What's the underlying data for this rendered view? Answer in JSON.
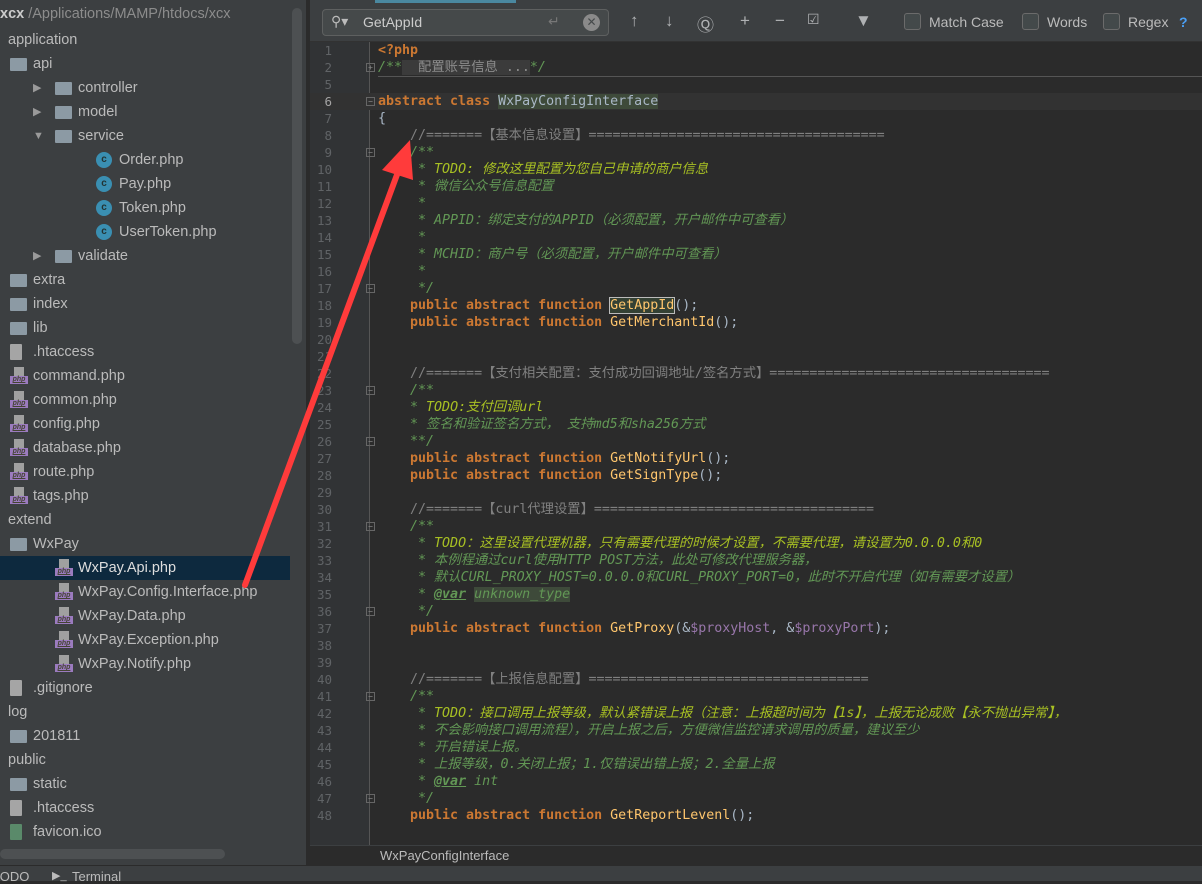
{
  "project": {
    "name": "xcx",
    "path": "/Applications/MAMP/htdocs/xcx"
  },
  "tree": [
    {
      "label": "application",
      "depth": 0,
      "icon": "module-folder"
    },
    {
      "label": "api",
      "depth": 1,
      "icon": "folder"
    },
    {
      "label": "controller",
      "depth": 2,
      "icon": "folder",
      "arrow": "collapsed"
    },
    {
      "label": "model",
      "depth": 2,
      "icon": "folder",
      "arrow": "collapsed"
    },
    {
      "label": "service",
      "depth": 2,
      "icon": "folder",
      "arrow": "expanded"
    },
    {
      "label": "Order.php",
      "depth": 3,
      "icon": "php-class"
    },
    {
      "label": "Pay.php",
      "depth": 3,
      "icon": "php-class"
    },
    {
      "label": "Token.php",
      "depth": 3,
      "icon": "php-class"
    },
    {
      "label": "UserToken.php",
      "depth": 3,
      "icon": "php-class"
    },
    {
      "label": "validate",
      "depth": 2,
      "icon": "folder",
      "arrow": "collapsed"
    },
    {
      "label": "extra",
      "depth": 1,
      "icon": "folder"
    },
    {
      "label": "index",
      "depth": 1,
      "icon": "folder"
    },
    {
      "label": "lib",
      "depth": 1,
      "icon": "folder"
    },
    {
      "label": ".htaccess",
      "depth": 1,
      "icon": "apache-file"
    },
    {
      "label": "command.php",
      "depth": 1,
      "icon": "php-file"
    },
    {
      "label": "common.php",
      "depth": 1,
      "icon": "php-file"
    },
    {
      "label": "config.php",
      "depth": 1,
      "icon": "php-file"
    },
    {
      "label": "database.php",
      "depth": 1,
      "icon": "php-file"
    },
    {
      "label": "route.php",
      "depth": 1,
      "icon": "php-file"
    },
    {
      "label": "tags.php",
      "depth": 1,
      "icon": "php-file"
    },
    {
      "label": "extend",
      "depth": 0,
      "icon": "module-folder"
    },
    {
      "label": "WxPay",
      "depth": 1,
      "icon": "folder"
    },
    {
      "label": "WxPay.Api.php",
      "depth": 2,
      "icon": "php-file",
      "selected": true
    },
    {
      "label": "WxPay.Config.Interface.php",
      "depth": 2,
      "icon": "php-file"
    },
    {
      "label": "WxPay.Data.php",
      "depth": 2,
      "icon": "php-file"
    },
    {
      "label": "WxPay.Exception.php",
      "depth": 2,
      "icon": "php-file"
    },
    {
      "label": "WxPay.Notify.php",
      "depth": 2,
      "icon": "php-file"
    },
    {
      "label": ".gitignore",
      "depth": 1,
      "icon": "text-file"
    },
    {
      "label": "log",
      "depth": 0,
      "icon": "module-folder"
    },
    {
      "label": "201811",
      "depth": 1,
      "icon": "folder"
    },
    {
      "label": "public",
      "depth": 0,
      "icon": "module-folder"
    },
    {
      "label": "static",
      "depth": 1,
      "icon": "folder"
    },
    {
      "label": ".htaccess",
      "depth": 1,
      "icon": "apache-file"
    },
    {
      "label": "favicon.ico",
      "depth": 1,
      "icon": "image-file"
    }
  ],
  "search": {
    "value": "GetAppId",
    "match_case": "Match Case",
    "words": "Words",
    "regex": "Regex",
    "help": "?"
  },
  "breadcrumb": "WxPayConfigInterface",
  "bottom_tabs": [
    "TODO",
    "Terminal"
  ],
  "colors": {
    "keyword": "#cc7832",
    "function": "#ffc66d",
    "comment": "#808080",
    "doc": "#629755",
    "todo": "#a8c023",
    "variable": "#9876aa",
    "annotation_arrow": "#ff3333"
  },
  "code": [
    {
      "n": "1",
      "t": [
        [
          "<?php",
          "kw"
        ]
      ]
    },
    {
      "n": "2",
      "t": [
        [
          "/**",
          "doc"
        ],
        [
          "  配置账号信息 ...",
          "fold"
        ],
        [
          "*/",
          "doc"
        ]
      ]
    },
    {
      "n": "5",
      "t": []
    },
    {
      "n": "6",
      "cur": true,
      "t": [
        [
          "abstract class ",
          "kw"
        ],
        [
          "WxPayConfigInterface",
          "bgv"
        ]
      ]
    },
    {
      "n": "7",
      "t": [
        [
          "{",
          ""
        ]
      ]
    },
    {
      "n": "8",
      "t": [
        [
          "    //=======【基本信息设置】=====================================",
          "cm"
        ]
      ]
    },
    {
      "n": "9",
      "t": [
        [
          "    /**",
          "doc"
        ]
      ]
    },
    {
      "n": "10",
      "t": [
        [
          "     * ",
          "doc"
        ],
        [
          "TODO: 修改这里配置为您自己申请的商户信息",
          "todo"
        ]
      ]
    },
    {
      "n": "11",
      "t": [
        [
          "     * 微信公众号信息配置",
          "doc"
        ]
      ]
    },
    {
      "n": "12",
      "t": [
        [
          "     *",
          "doc"
        ]
      ]
    },
    {
      "n": "13",
      "t": [
        [
          "     * APPID：绑定支付的APPID（必须配置，开户邮件中可查看）",
          "doc"
        ]
      ]
    },
    {
      "n": "14",
      "t": [
        [
          "     *",
          "doc"
        ]
      ]
    },
    {
      "n": "15",
      "t": [
        [
          "     * MCHID：商户号（必须配置，开户邮件中可查看）",
          "doc"
        ]
      ]
    },
    {
      "n": "16",
      "t": [
        [
          "     *",
          "doc"
        ]
      ]
    },
    {
      "n": "17",
      "t": [
        [
          "     */",
          "doc"
        ]
      ]
    },
    {
      "n": "18",
      "t": [
        [
          "    public abstract function ",
          "kw"
        ],
        [
          "GetAppId",
          "fn hl"
        ],
        [
          "();",
          ""
        ]
      ]
    },
    {
      "n": "19",
      "t": [
        [
          "    public abstract function ",
          "kw"
        ],
        [
          "GetMerchantId",
          "fn"
        ],
        [
          "();",
          ""
        ]
      ]
    },
    {
      "n": "20",
      "t": []
    },
    {
      "n": "21",
      "t": []
    },
    {
      "n": "22",
      "t": [
        [
          "    //=======【支付相关配置：支付成功回调地址/签名方式】===================================",
          "cm"
        ]
      ]
    },
    {
      "n": "23",
      "t": [
        [
          "    /**",
          "doc"
        ]
      ]
    },
    {
      "n": "24",
      "t": [
        [
          "    * ",
          "doc"
        ],
        [
          "TODO:支付回调url",
          "todo"
        ]
      ]
    },
    {
      "n": "25",
      "t": [
        [
          "    * 签名和验证签名方式， 支持md5和sha256方式",
          "doc"
        ]
      ]
    },
    {
      "n": "26",
      "t": [
        [
          "    **/",
          "doc"
        ]
      ]
    },
    {
      "n": "27",
      "t": [
        [
          "    public abstract function ",
          "kw"
        ],
        [
          "GetNotifyUrl",
          "fn"
        ],
        [
          "();",
          ""
        ]
      ]
    },
    {
      "n": "28",
      "t": [
        [
          "    public abstract function ",
          "kw"
        ],
        [
          "GetSignType",
          "fn"
        ],
        [
          "();",
          ""
        ]
      ]
    },
    {
      "n": "29",
      "t": []
    },
    {
      "n": "30",
      "t": [
        [
          "    //=======【curl代理设置】===================================",
          "cm"
        ]
      ]
    },
    {
      "n": "31",
      "t": [
        [
          "    /**",
          "doc"
        ]
      ]
    },
    {
      "n": "32",
      "t": [
        [
          "     * ",
          "doc"
        ],
        [
          "TODO：这里设置代理机器，只有需要代理的时候才设置，不需要代理，请设置为0.0.0.0和0",
          "todo"
        ]
      ]
    },
    {
      "n": "33",
      "t": [
        [
          "     * 本例程通过curl使用HTTP POST方法，此处可修改代理服务器，",
          "doc"
        ]
      ]
    },
    {
      "n": "34",
      "t": [
        [
          "     * 默认CURL_PROXY_HOST=0.0.0.0和CURL_PROXY_PORT=0，此时不开启代理（如有需要才设置）",
          "doc"
        ]
      ]
    },
    {
      "n": "35",
      "t": [
        [
          "     * ",
          "doc"
        ],
        [
          "@var",
          "tag"
        ],
        [
          " ",
          "doc"
        ],
        [
          "unknown_type",
          "doc bgv"
        ]
      ]
    },
    {
      "n": "36",
      "t": [
        [
          "     */",
          "doc"
        ]
      ]
    },
    {
      "n": "37",
      "t": [
        [
          "    public abstract function ",
          "kw"
        ],
        [
          "GetProxy",
          "fn"
        ],
        [
          "(&",
          ""
        ],
        [
          "$proxyHost",
          "var"
        ],
        [
          ", &",
          ""
        ],
        [
          "$proxyPort",
          "var"
        ],
        [
          ");",
          ""
        ]
      ]
    },
    {
      "n": "38",
      "t": []
    },
    {
      "n": "39",
      "t": []
    },
    {
      "n": "40",
      "t": [
        [
          "    //=======【上报信息配置】===================================",
          "cm"
        ]
      ]
    },
    {
      "n": "41",
      "t": [
        [
          "    /**",
          "doc"
        ]
      ]
    },
    {
      "n": "42",
      "t": [
        [
          "     * ",
          "doc"
        ],
        [
          "TODO：接口调用上报等级，默认紧错误上报（注意：上报超时间为【1s】，上报无论成败【永不抛出异常】，",
          "todo"
        ]
      ]
    },
    {
      "n": "43",
      "t": [
        [
          "     * 不会影响接口调用流程），开启上报之后，方便微信监控请求调用的质量，建议至少",
          "doc"
        ]
      ]
    },
    {
      "n": "44",
      "t": [
        [
          "     * 开启错误上报。",
          "doc"
        ]
      ]
    },
    {
      "n": "45",
      "t": [
        [
          "     * 上报等级，0.关闭上报；1.仅错误出错上报；2.全量上报",
          "doc"
        ]
      ]
    },
    {
      "n": "46",
      "t": [
        [
          "     * ",
          "doc"
        ],
        [
          "@var",
          "tag"
        ],
        [
          " int",
          "doc"
        ]
      ]
    },
    {
      "n": "47",
      "t": [
        [
          "     */",
          "doc"
        ]
      ]
    },
    {
      "n": "48",
      "t": [
        [
          "    public abstract function ",
          "kw"
        ],
        [
          "GetReportLevenl",
          "fn"
        ],
        [
          "();",
          ""
        ]
      ]
    }
  ]
}
